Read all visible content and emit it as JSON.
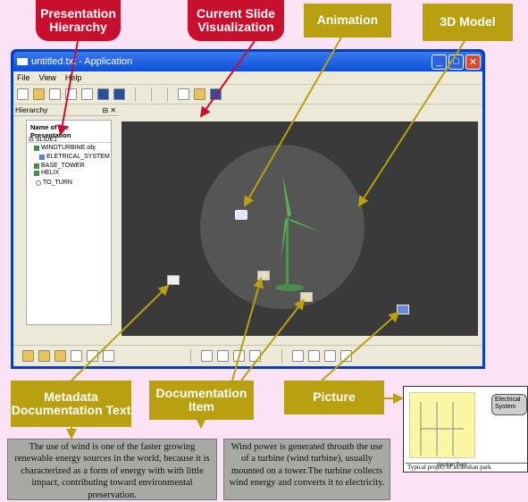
{
  "callouts": {
    "hierarchy": "Presentation Hierarchy",
    "current_slide": "Current Slide Visualization",
    "animation": "Animation",
    "model": "3D Model",
    "metadata": "Metadata Documentation Text",
    "doc_item": "Documentation Item",
    "picture": "Picture"
  },
  "window": {
    "title": "untitled.txt - Application",
    "menu": [
      "File",
      "View",
      "Help"
    ],
    "panel_title": "Hierarchy",
    "panel_controls": "⊟ ✕"
  },
  "tree": {
    "header": "Name of the Presentation",
    "nodes": [
      "SLIDE1",
      "WINDTURBINE.obj",
      "ELETRICAL_SYSTEM",
      "BASE_TOWER",
      "HELIX",
      "TO_TURN"
    ]
  },
  "descriptions": {
    "left": "The use of wind is one of the faster growing renewable energy sources in the world, because it is characterized as a form of energy with with little impact, contributing toward environmental preservation.",
    "right": "Wind power is generated throuth the use of a turbine (wind turbine), usually mounted on a tower.The turbine collects wind energy and converts it to electricity."
  },
  "picture": {
    "system_label": "Electrical System",
    "park_label": "Aeolian Park",
    "caption": "Typical project of an'aeolian park"
  },
  "colors": {
    "red_callout": "#c8102e",
    "gold_callout": "#b8a010",
    "viewport": "#3a3a3a"
  }
}
